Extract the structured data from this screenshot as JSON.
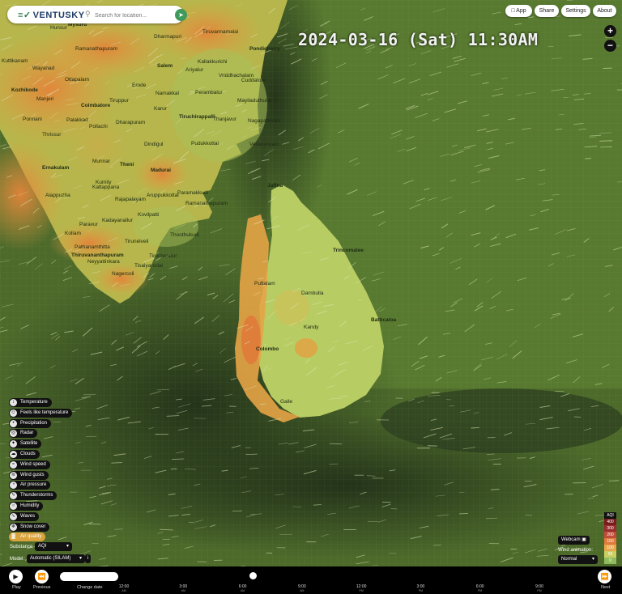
{
  "brand": {
    "name": "VENTUSKY",
    "mark": "≡✓"
  },
  "search": {
    "placeholder": "Search for location..."
  },
  "top_buttons": [
    "App",
    "Share",
    "Settings",
    "About"
  ],
  "datetime": "2024-03-16 (Sat) 11:30AM",
  "zoom": {
    "in": "+",
    "out": "−"
  },
  "layers": [
    {
      "label": "Temperature",
      "icon": "thermometer-icon",
      "glyph": "↕"
    },
    {
      "label": "Feels like temperature",
      "icon": "person-icon",
      "glyph": "☺"
    },
    {
      "label": "Precipitation",
      "icon": "drop-icon",
      "glyph": "•"
    },
    {
      "label": "Radar",
      "icon": "radar-icon",
      "glyph": "◎"
    },
    {
      "label": "Satellite",
      "icon": "satellite-icon",
      "glyph": "✦"
    },
    {
      "label": "Clouds",
      "icon": "cloud-icon",
      "glyph": "☁"
    },
    {
      "label": "Wind speed",
      "icon": "wind-icon",
      "glyph": "≈"
    },
    {
      "label": "Wind gusts",
      "icon": "gust-icon",
      "glyph": "≋"
    },
    {
      "label": "Air pressure",
      "icon": "pressure-icon",
      "glyph": "◔"
    },
    {
      "label": "Thunderstorms",
      "icon": "lightning-icon",
      "glyph": "ϟ"
    },
    {
      "label": "Humidity",
      "icon": "humidity-icon",
      "glyph": "○"
    },
    {
      "label": "Waves",
      "icon": "wave-icon",
      "glyph": "∿"
    },
    {
      "label": "Snow cover",
      "icon": "snow-icon",
      "glyph": "❄"
    },
    {
      "label": "Air quality",
      "icon": "air-quality-icon",
      "glyph": "▓",
      "active": true
    }
  ],
  "substance": {
    "label": "Substance",
    "value": "AQI"
  },
  "model": {
    "label": "Model",
    "value": "Automatic (SILAM)"
  },
  "legend": {
    "title": "AQI",
    "steps": [
      {
        "value": "400",
        "color": "#7a1c1c"
      },
      {
        "value": "300",
        "color": "#9a2d2d"
      },
      {
        "value": "200",
        "color": "#c24c3a"
      },
      {
        "value": "150",
        "color": "#e07a3a"
      },
      {
        "value": "100",
        "color": "#eba54a"
      },
      {
        "value": "50",
        "color": "#c9cf62"
      },
      {
        "value": "0",
        "color": "#8fbb5e"
      }
    ]
  },
  "webcam": {
    "label": "Webcam"
  },
  "wind_animation": {
    "label": "Wind animation:",
    "value": "Normal"
  },
  "timeline": {
    "play": "Play",
    "previous": "Previous",
    "next": "Next",
    "change_date": "Change date",
    "ticks": [
      {
        "time": "12:00",
        "ampm": "AM"
      },
      {
        "time": "3:00",
        "ampm": "AM"
      },
      {
        "time": "6:00",
        "ampm": "AM"
      },
      {
        "time": "9:00",
        "ampm": "AM"
      },
      {
        "time": "12:00",
        "ampm": "PM"
      },
      {
        "time": "3:00",
        "ampm": "PM"
      },
      {
        "time": "6:00",
        "ampm": "PM"
      },
      {
        "time": "9:00",
        "ampm": "PM"
      }
    ],
    "current_position": 0.31
  },
  "cities": [
    "Mysuru",
    "Hunsur",
    "Tiruvannamalai",
    "Dharmapuri",
    "Pondicherry",
    "Kallakkurichi",
    "Ramanathapuram",
    "Salem",
    "Ariyalur",
    "Vriddhachalam",
    "Cuddalore",
    "Namakkal",
    "Perambalur",
    "Mayiladuthurai",
    "Tiruchirappalli",
    "Karur",
    "Erode",
    "Tiruppur",
    "Coimbatore",
    "Palakkad",
    "Thrissur",
    "Pollachi",
    "Dharapuram",
    "Pudukkottai",
    "Thanjavur",
    "Nagapattinam",
    "Vedaranyam",
    "Dindigul",
    "Madurai",
    "Theni",
    "Munnar",
    "Ernakulam",
    "Alappuzha",
    "Kollam",
    "Thiruvananthapuram",
    "Neyyattinkara",
    "Kadayanallur",
    "Tirunelveli",
    "Kovilpatti",
    "Rajapalayam",
    "Aruppukkottai",
    "Paramakkudi",
    "Ramanathapuram",
    "Thoothukudi",
    "Tiruchendur",
    "Tisaiyanvilai",
    "Nagercoil",
    "Kozhikode",
    "Manjeri",
    "Ottapalam",
    "Ponnani",
    "Wayanad",
    "Jaffna",
    "Trincomalee",
    "Puttalam",
    "Dambulla",
    "Kandy",
    "Batticaloa",
    "Colombo",
    "Galle",
    "Kattappana",
    "Paravur",
    "Kumily",
    "Kuttikanam",
    "Pathanamthitta"
  ]
}
